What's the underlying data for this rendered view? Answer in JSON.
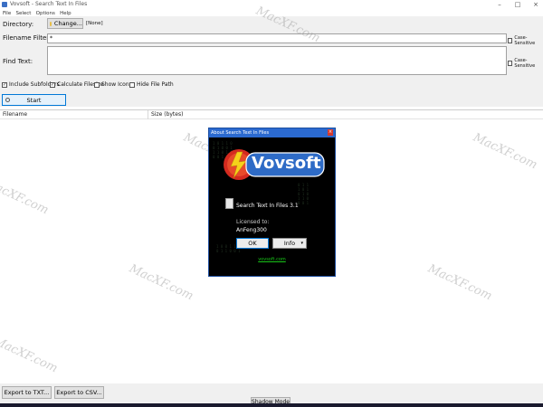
{
  "window": {
    "title": "Vovsoft - Search Text In Files"
  },
  "menu": {
    "items": [
      "File",
      "Select",
      "Options",
      "Help"
    ]
  },
  "form": {
    "directory_label": "Directory:",
    "change_label": "Change...",
    "directory_value": "[None]",
    "filename_filter_label": "Filename Filter:",
    "filename_filter_value": "*",
    "case_sensitive_label": "Case-Sensitive",
    "find_text_label": "Find Text:",
    "find_text_value": "",
    "include_subfolders_label": "Include Subfolders",
    "calculate_filesize_label": "Calculate Filesize",
    "show_icons_label": "Show Icons",
    "hide_file_path_label": "Hide File Path",
    "start_label": "Start"
  },
  "results": {
    "columns": [
      "Filename",
      "Size (bytes)"
    ]
  },
  "bottom": {
    "export_txt_label": "Export to TXT...",
    "export_csv_label": "Export to CSV...",
    "shadow_mode_label": "Shadow Mode"
  },
  "dialog": {
    "title": "About Search Text In Files",
    "close_glyph": "×",
    "logo_text": "Vovsoft",
    "product": "Search Text In Files 3.1",
    "licensed_label": "Licensed to:",
    "licensee": "AnFeng300",
    "ok_label": "OK",
    "info_label": "Info",
    "info_arrow": "▾",
    "link_text": "vovsoft.com"
  },
  "watermark": {
    "text": "MacXF.com"
  },
  "colors": {
    "dialog_title": "#2b6ad0",
    "logo_red": "#d42a1f",
    "logo_blue": "#2e6bc6",
    "link_green": "#18c418"
  }
}
